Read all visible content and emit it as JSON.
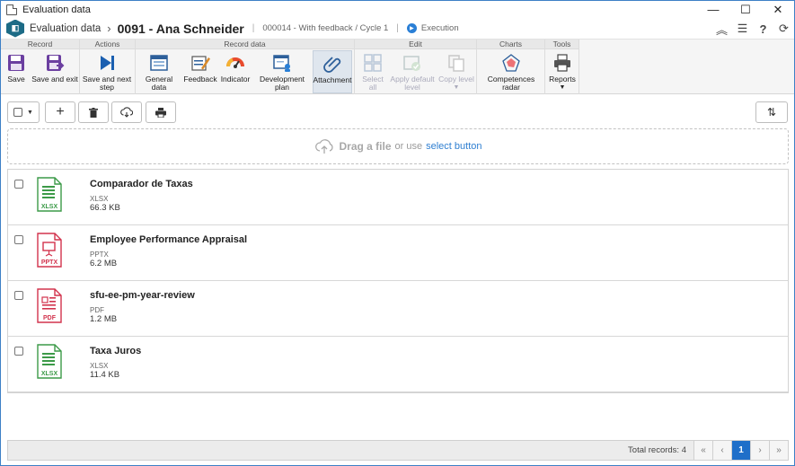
{
  "window": {
    "title": "Evaluation data",
    "minimize": "—",
    "maximize": "☐",
    "close": "✕"
  },
  "header": {
    "logo_glyph": "◧",
    "breadcrumb": "Evaluation data",
    "record_title": "0091 - Ana Schneider",
    "subtitle": "000014 - With feedback / Cycle 1",
    "status": "Execution",
    "icons": [
      "collapse-up-icon",
      "list-icon",
      "help-icon",
      "refresh-icon"
    ]
  },
  "ribbon": {
    "groups": {
      "record": "Record",
      "actions": "Actions",
      "record_data": "Record data",
      "edit": "Edit",
      "charts": "Charts",
      "tools": "Tools"
    },
    "buttons": {
      "save": "Save",
      "save_exit": "Save and exit",
      "save_next": "Save and next step",
      "general_data": "General data",
      "feedback": "Feedback",
      "indicator": "Indicator",
      "development_plan": "Development plan",
      "attachment": "Attachment",
      "select_all": "Select all",
      "apply_default": "Apply default level",
      "copy_level": "Copy level",
      "competences_radar": "Competences radar",
      "reports": "Reports"
    }
  },
  "toolbar": {
    "add": "+",
    "delete": "🗑",
    "download": "☁",
    "print": "🖶",
    "sort": "⇅"
  },
  "dropzone": {
    "main": "Drag a file",
    "or": "or use",
    "link": "select button"
  },
  "files": [
    {
      "name": "Comparador de Taxas",
      "ext": "XLSX",
      "size": "66.3 KB",
      "type": "xlsx"
    },
    {
      "name": "Employee Performance Appraisal",
      "ext": "PPTX",
      "size": "6.2 MB",
      "type": "pptx"
    },
    {
      "name": "sfu-ee-pm-year-review",
      "ext": "PDF",
      "size": "1.2 MB",
      "type": "pdf"
    },
    {
      "name": "Taxa Juros",
      "ext": "XLSX",
      "size": "11.4 KB",
      "type": "xlsx"
    }
  ],
  "footer": {
    "total_records": "Total records: 4",
    "first": "«",
    "prev": "‹",
    "page": "1",
    "next": "›",
    "last": "»"
  },
  "colors": {
    "accent": "#1f6fc9",
    "xlsx": "#3c9a48",
    "pptx": "#d2334d",
    "pdf": "#d2334d"
  }
}
